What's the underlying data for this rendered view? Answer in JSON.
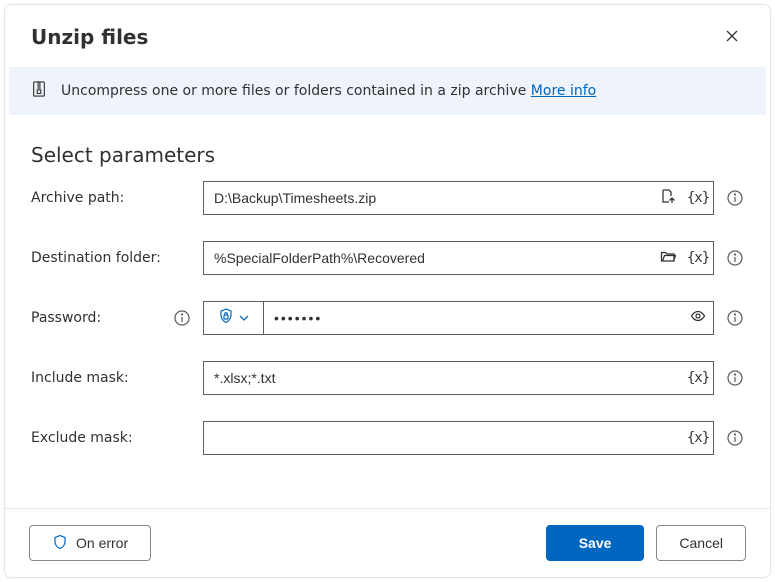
{
  "dialog": {
    "title": "Unzip files"
  },
  "banner": {
    "text": "Uncompress one or more files or folders contained in a zip archive ",
    "link": "More info"
  },
  "section": {
    "title": "Select parameters"
  },
  "fields": {
    "archive": {
      "label": "Archive path:",
      "value": "D:\\Backup\\Timesheets.zip"
    },
    "destination": {
      "label": "Destination folder:",
      "value": "%SpecialFolderPath%\\Recovered"
    },
    "password": {
      "label": "Password:",
      "value": "•••••••"
    },
    "include": {
      "label": "Include mask:",
      "value": "*.xlsx;*.txt"
    },
    "exclude": {
      "label": "Exclude mask:",
      "value": ""
    }
  },
  "footer": {
    "onError": "On error",
    "save": "Save",
    "cancel": "Cancel"
  }
}
